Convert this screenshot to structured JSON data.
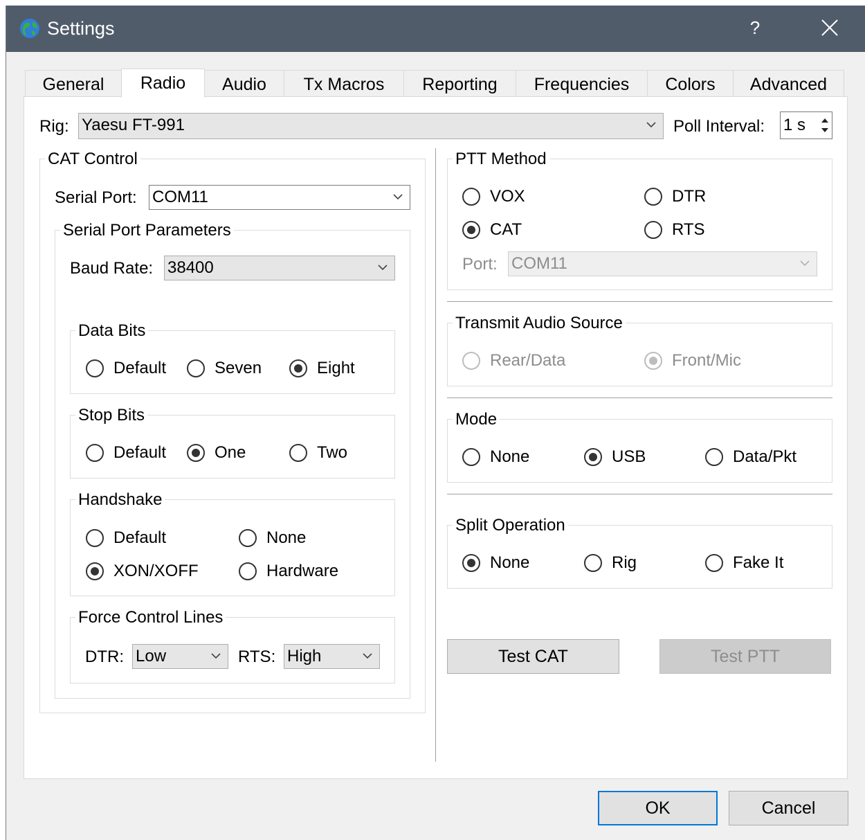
{
  "window": {
    "title": "Settings",
    "help_label": "?",
    "title_bar_color": "#515c6b"
  },
  "tabs": [
    {
      "label": "General",
      "active": false
    },
    {
      "label": "Radio",
      "active": true
    },
    {
      "label": "Audio",
      "active": false
    },
    {
      "label": "Tx Macros",
      "active": false
    },
    {
      "label": "Reporting",
      "active": false
    },
    {
      "label": "Frequencies",
      "active": false
    },
    {
      "label": "Colors",
      "active": false
    },
    {
      "label": "Advanced",
      "active": false
    }
  ],
  "rig": {
    "label": "Rig:",
    "value": "Yaesu FT-991",
    "poll_label": "Poll Interval:",
    "poll_value": "1 s"
  },
  "cat": {
    "title": "CAT Control",
    "serial_port_label": "Serial Port:",
    "serial_port_value": "COM11",
    "params_title": "Serial Port Parameters",
    "baud_label": "Baud Rate:",
    "baud_value": "38400",
    "data_bits": {
      "title": "Data Bits",
      "options": [
        "Default",
        "Seven",
        "Eight"
      ],
      "selected": "Eight"
    },
    "stop_bits": {
      "title": "Stop Bits",
      "options": [
        "Default",
        "One",
        "Two"
      ],
      "selected": "One"
    },
    "handshake": {
      "title": "Handshake",
      "options": [
        "Default",
        "None",
        "XON/XOFF",
        "Hardware"
      ],
      "selected": "XON/XOFF"
    },
    "force": {
      "title": "Force Control Lines",
      "dtr_label": "DTR:",
      "dtr_value": "Low",
      "rts_label": "RTS:",
      "rts_value": "High"
    }
  },
  "ptt": {
    "title": "PTT Method",
    "options": [
      "VOX",
      "DTR",
      "CAT",
      "RTS"
    ],
    "selected": "CAT",
    "port_label": "Port:",
    "port_value": "COM11"
  },
  "audio_source": {
    "title": "Transmit Audio Source",
    "options": [
      "Rear/Data",
      "Front/Mic"
    ],
    "selected": "Front/Mic"
  },
  "mode": {
    "title": "Mode",
    "options": [
      "None",
      "USB",
      "Data/Pkt"
    ],
    "selected": "USB"
  },
  "split": {
    "title": "Split Operation",
    "options": [
      "None",
      "Rig",
      "Fake It"
    ],
    "selected": "None"
  },
  "buttons": {
    "test_cat": "Test CAT",
    "test_ptt": "Test PTT",
    "ok": "OK",
    "cancel": "Cancel"
  },
  "icons": {
    "app": "globe-icon",
    "help": "help-icon",
    "close": "close-icon"
  }
}
